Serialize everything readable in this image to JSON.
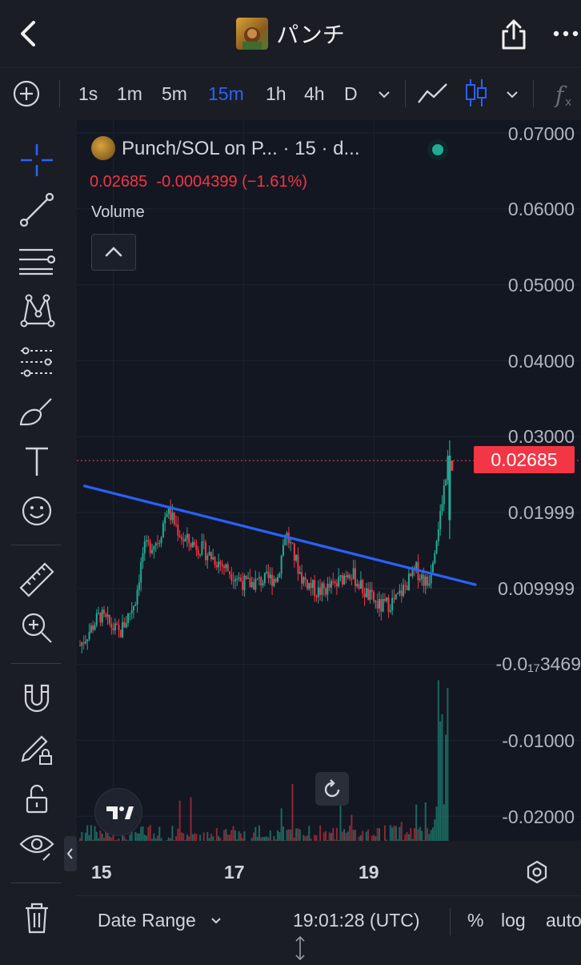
{
  "header": {
    "title": "パンチ",
    "back_icon": "chevron-left-icon",
    "share_icon": "share-icon",
    "more_icon": "more-horizontal-icon"
  },
  "intervals": {
    "items": [
      "1s",
      "1m",
      "5m",
      "15m",
      "1h",
      "4h",
      "D"
    ],
    "active": "15m"
  },
  "toolbar_icons": [
    "add-circle-icon",
    "chevron-down-icon",
    "line-chart-icon",
    "candlestick-icon",
    "chevron-down-icon",
    "indicator-fx-icon"
  ],
  "left_tools": [
    "crosshair-icon",
    "trend-line-icon",
    "fib-retracement-icon",
    "pattern-icon",
    "prediction-icon",
    "brush-icon",
    "text-icon",
    "emoji-icon",
    "ruler-icon",
    "zoom-in-icon",
    "magnet-icon",
    "lock-drawing-icon",
    "unlock-icon",
    "eye-icon",
    "trash-icon"
  ],
  "legend": {
    "title": "Punch/SOL on P... · 15 · d...",
    "price": "0.02685",
    "change": "-0.0004399 (−1.61%)",
    "volume_label": "Volume"
  },
  "price_axis": {
    "labels": [
      "0.07000",
      "0.06000",
      "0.05000",
      "0.04000",
      "0.03000",
      "0.01999",
      "0.009999",
      "-0.0₁₇3469",
      "-0.01000",
      "-0.02000"
    ],
    "current_price_tag": "0.02685"
  },
  "time_axis": {
    "labels": [
      "15",
      "17",
      "19"
    ]
  },
  "bottom_bar": {
    "date_range": "Date Range",
    "time": "19:01:28 (UTC)",
    "percent": "%",
    "log": "log",
    "auto": "auto"
  },
  "colors": {
    "background": "#131722",
    "up": "#22ab94",
    "down": "#f23645",
    "trendline": "#2962ff",
    "active_interval": "#2962ff"
  },
  "chart_data": {
    "type": "candlestick",
    "title": "Punch/SOL on P... · 15 · d...",
    "ylabel": "",
    "ylim": [
      -0.025,
      0.0725
    ],
    "x_ticks": [
      "15",
      "17",
      "19"
    ],
    "last_price": 0.02685,
    "close_path": [
      {
        "x": 0.0,
        "y": 0.0025
      },
      {
        "x": 0.05,
        "y": 0.0065
      },
      {
        "x": 0.1,
        "y": 0.004
      },
      {
        "x": 0.14,
        "y": 0.0085
      },
      {
        "x": 0.16,
        "y": 0.015
      },
      {
        "x": 0.2,
        "y": 0.0165
      },
      {
        "x": 0.22,
        "y": 0.0205
      },
      {
        "x": 0.26,
        "y": 0.0165
      },
      {
        "x": 0.3,
        "y": 0.0155
      },
      {
        "x": 0.35,
        "y": 0.0135
      },
      {
        "x": 0.42,
        "y": 0.0105
      },
      {
        "x": 0.5,
        "y": 0.0115
      },
      {
        "x": 0.52,
        "y": 0.0175
      },
      {
        "x": 0.56,
        "y": 0.0115
      },
      {
        "x": 0.6,
        "y": 0.0095
      },
      {
        "x": 0.65,
        "y": 0.0105
      },
      {
        "x": 0.68,
        "y": 0.0125
      },
      {
        "x": 0.72,
        "y": 0.0095
      },
      {
        "x": 0.76,
        "y": 0.0075
      },
      {
        "x": 0.8,
        "y": 0.0085
      },
      {
        "x": 0.85,
        "y": 0.0125
      },
      {
        "x": 0.88,
        "y": 0.0105
      },
      {
        "x": 0.91,
        "y": 0.0195
      },
      {
        "x": 0.93,
        "y": 0.02685
      }
    ],
    "trendline": {
      "start": {
        "x": 0.08,
        "y": 0.0235
      },
      "end": {
        "x": 1.0,
        "y": 0.0105
      }
    }
  }
}
